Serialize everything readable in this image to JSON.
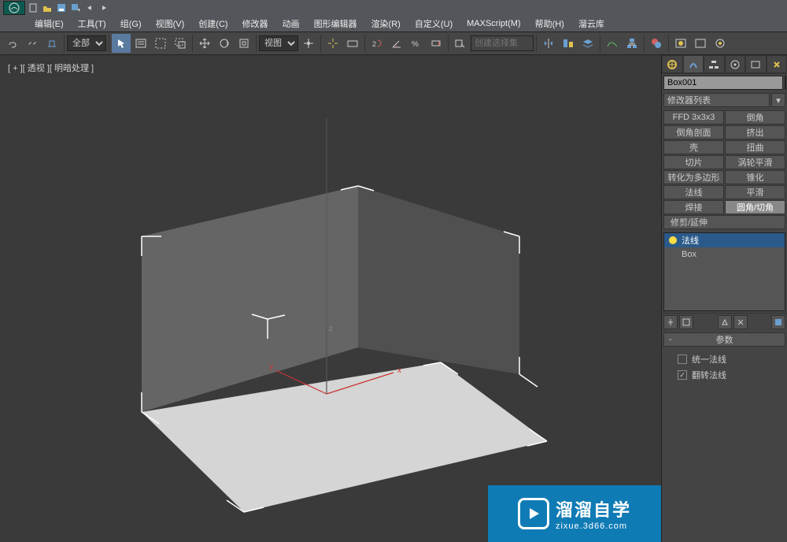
{
  "qat": {
    "icons": [
      "new",
      "open",
      "save",
      "plus",
      "undo",
      "redo"
    ]
  },
  "menu": {
    "items": [
      "编辑(E)",
      "工具(T)",
      "组(G)",
      "视图(V)",
      "创建(C)",
      "修改器",
      "动画",
      "图形编辑器",
      "渲染(R)",
      "自定义(U)",
      "MAXScript(M)",
      "帮助(H)",
      "溜云库"
    ]
  },
  "toolbar": {
    "all_label": "全部",
    "view_label": "视图",
    "selection_set_placeholder": "创建选择集"
  },
  "viewport": {
    "label": "[ + ][ 透视 ][ 明暗处理 ]",
    "axis": {
      "x": "x",
      "y": "y",
      "z": "z"
    }
  },
  "panel": {
    "object_name": "Box001",
    "modifier_list_label": "修改器列表",
    "mod_buttons": [
      [
        "FFD 3x3x3",
        "倒角"
      ],
      [
        "倒角剖面",
        "挤出"
      ],
      [
        "壳",
        "扭曲"
      ],
      [
        "切片",
        "涡轮平滑"
      ],
      [
        "转化为多边形",
        "锥化"
      ],
      [
        "法线",
        "平滑"
      ],
      [
        "焊接",
        "圆角/切角"
      ]
    ],
    "trim_extend": "修剪/延伸",
    "stack": [
      {
        "label": "法线",
        "selected": true,
        "bulb": true
      },
      {
        "label": "Box",
        "selected": false,
        "bulb": false
      }
    ],
    "rollout_title": "参数",
    "params": {
      "unify": "统一法线",
      "flip": "翻转法线"
    }
  },
  "watermark": {
    "title": "溜溜自学",
    "url": "zixue.3d66.com"
  }
}
